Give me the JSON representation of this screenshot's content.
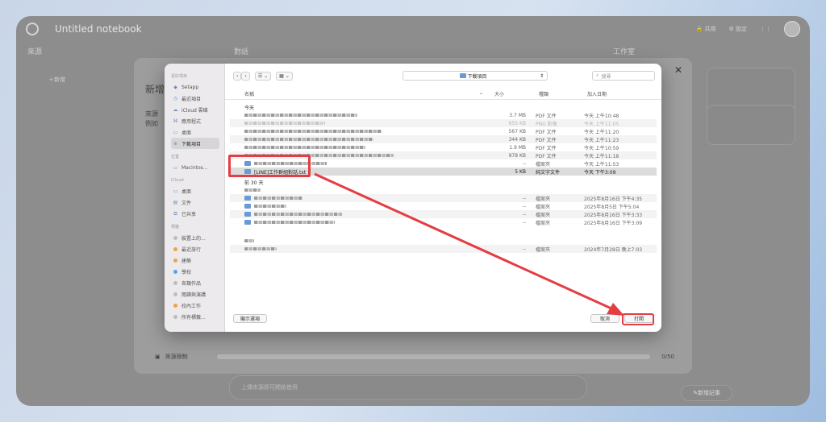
{
  "app": {
    "title": "Untitled notebook",
    "share": "共用",
    "settings": "設定",
    "sources_hdr": "來源",
    "chat_hdr": "對話",
    "studio_hdr": "工作室",
    "add_btn": "新增",
    "new_note_btn": "新增記事",
    "chat_placeholder": "上傳來源即可開始使用"
  },
  "modal": {
    "heading": "新增",
    "line1": "來源",
    "line2": "例如",
    "limit_label": "來源限制",
    "limit_count": "0/50"
  },
  "dialog": {
    "sidebar": {
      "favorites_label": "喜好項目",
      "favorites": [
        {
          "icon": "setapp-icon",
          "label": "Setapp"
        },
        {
          "icon": "clock-icon",
          "label": "最近項目"
        },
        {
          "icon": "cloud-icon",
          "label": "iCloud 雲碟"
        },
        {
          "icon": "apps-icon",
          "label": "應用程式"
        },
        {
          "icon": "desktop-icon",
          "label": "桌面"
        },
        {
          "icon": "download-icon",
          "label": "下載項目"
        }
      ],
      "locations_label": "位置",
      "locations": [
        {
          "icon": "disk-icon",
          "label": "Macintos..."
        }
      ],
      "icloud_label": "iCloud",
      "icloud": [
        {
          "icon": "desktop-icon",
          "label": "桌面"
        },
        {
          "icon": "doc-icon",
          "label": "文件"
        },
        {
          "icon": "shared-icon",
          "label": "已共享"
        }
      ],
      "tags_label": "標籤",
      "tags": [
        {
          "color": "#bdbdbd",
          "label": "裝置上的..."
        },
        {
          "color": "#f0a14a",
          "label": "最近旅行"
        },
        {
          "color": "#f0a14a",
          "label": "建築"
        },
        {
          "color": "#5aa2e6",
          "label": "學校"
        },
        {
          "color": "#bdbdbd",
          "label": "各類作品"
        },
        {
          "color": "#bdbdbd",
          "label": "閱讀與演講"
        },
        {
          "color": "#f0a14a",
          "label": "校內工作"
        },
        {
          "color": "#bdbdbd",
          "label": "所有標籤..."
        }
      ]
    },
    "location": "下載項目",
    "search_placeholder": "搜尋",
    "columns": {
      "name": "名稱",
      "size": "大小",
      "kind": "種類",
      "date": "加入日期"
    },
    "groups": [
      {
        "label": "今天",
        "rows": [
          {
            "blur": 140,
            "size": "3.7 MB",
            "kind": "PDF 文件",
            "date": "今天 上午10:48"
          },
          {
            "blur": 100,
            "size": "655 KB",
            "kind": "PNG 影像",
            "date": "今天 上午11:05",
            "faded": true
          },
          {
            "blur": 170,
            "size": "567 KB",
            "kind": "PDF 文件",
            "date": "今天 上午11:20"
          },
          {
            "blur": 160,
            "size": "344 KB",
            "kind": "PDF 文件",
            "date": "今天 上午11:23"
          },
          {
            "blur": 150,
            "size": "1.9 MB",
            "kind": "PDF 文件",
            "date": "今天 上午10:59"
          },
          {
            "blur": 185,
            "size": "978 KB",
            "kind": "PDF 文件",
            "date": "今天 上午11:18"
          },
          {
            "blur": 90,
            "size": "--",
            "kind": "檔案夾",
            "date": "今天 上午11:53",
            "folder": true
          },
          {
            "name": "[LINE]工作群組對話.txt",
            "size": "5 KB",
            "kind": "純文字文件",
            "date": "今天 下午3:09",
            "selected": true
          }
        ]
      },
      {
        "label": "前 30 天",
        "rows": [
          {
            "blur": 20,
            "size": "",
            "kind": "",
            "date": ""
          },
          {
            "blur": 60,
            "size": "--",
            "kind": "檔案夾",
            "date": "2025年8月16日 下午4:35",
            "folder": true
          },
          {
            "blur": 40,
            "size": "--",
            "kind": "檔案夾",
            "date": "2025年8月5日 下午5:04",
            "folder": true
          },
          {
            "blur": 110,
            "size": "--",
            "kind": "檔案夾",
            "date": "2025年8月16日 下午3:33",
            "folder": true
          },
          {
            "blur": 100,
            "size": "--",
            "kind": "檔案夾",
            "date": "2025年8月16日 下午3:09",
            "folder": true
          }
        ]
      },
      {
        "label": "",
        "rows": [
          {
            "blur": 12,
            "size": "",
            "kind": "",
            "date": ""
          },
          {
            "blur": 40,
            "size": "--",
            "kind": "檔案夾",
            "date": "2024年7月28日 晚上7:03"
          }
        ]
      }
    ],
    "options_btn": "顯示選項",
    "cancel_btn": "取消",
    "open_btn": "打開"
  },
  "annotation_color": "#e43d43"
}
